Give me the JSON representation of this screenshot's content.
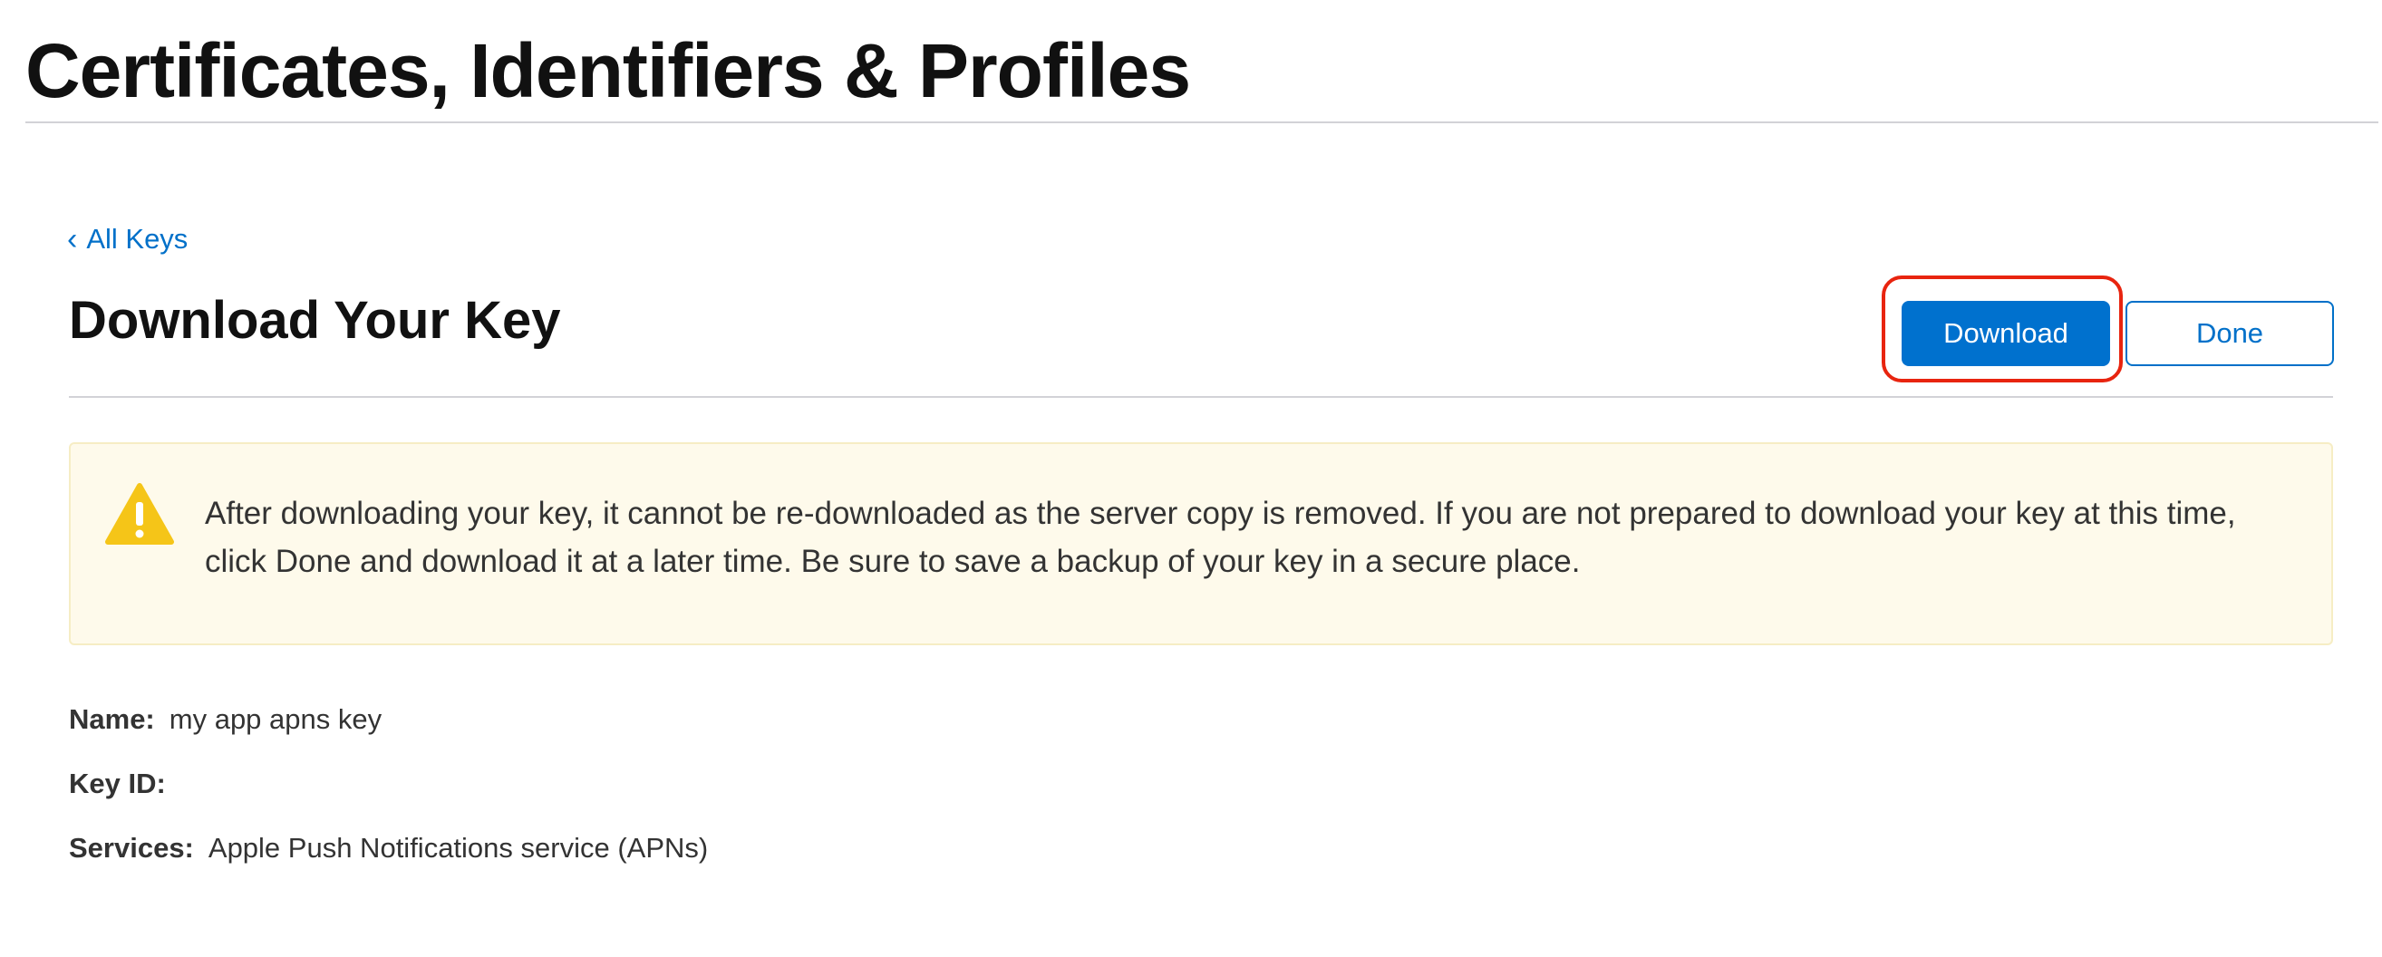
{
  "header": {
    "title": "Certificates, Identifiers & Profiles"
  },
  "nav": {
    "back_chevron": "‹",
    "back_label": "All Keys"
  },
  "section": {
    "title": "Download Your Key"
  },
  "actions": {
    "download_label": "Download",
    "done_label": "Done"
  },
  "notice": {
    "icon": "warning-triangle-icon",
    "text": "After downloading your key, it cannot be re-downloaded as the server copy is removed. If you are not prepared to download your key at this time, click Done and download it at a later time. Be sure to save a backup of your key in a secure place."
  },
  "details": {
    "name_label": "Name:",
    "name_value": "my app apns key",
    "key_id_label": "Key ID:",
    "key_id_value": "",
    "services_label": "Services:",
    "services_value": "Apple Push Notifications service (APNs)"
  },
  "colors": {
    "accent": "#0071ce",
    "notice_background": "#fefaeb",
    "warning_icon": "#f5c518",
    "highlight_ring": "#e8240f"
  }
}
